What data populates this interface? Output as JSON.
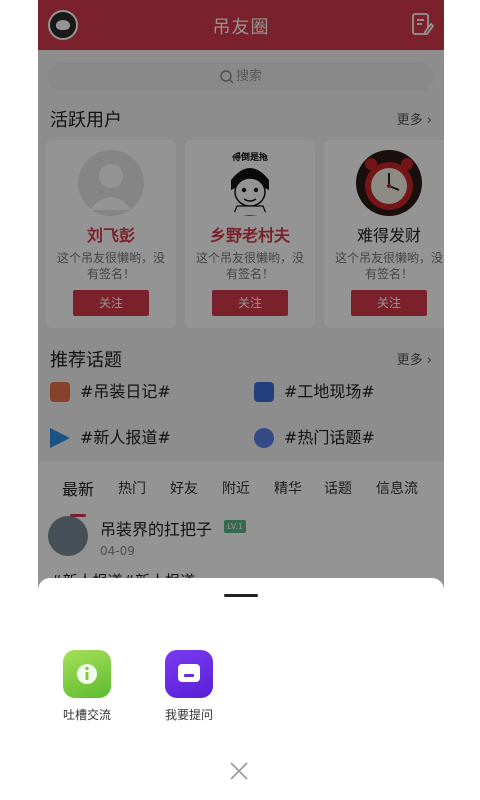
{
  "header": {
    "title": "吊友圈"
  },
  "search": {
    "placeholder": "搜索"
  },
  "active_users": {
    "heading": "活跃用户",
    "more": "更多",
    "users": [
      {
        "name": "刘飞彭",
        "signature": "这个吊友很懒哟，没有签名！",
        "follow": "关注"
      },
      {
        "name": "乡野老村夫",
        "signature": "这个吊友很懒哟，没有签名！",
        "follow": "关注",
        "avatar_text": "得倒是拖"
      },
      {
        "name": "难得发财",
        "signature": "这个吊友很懒哟，没有签名！",
        "follow": "关注"
      }
    ]
  },
  "topics": {
    "heading": "推荐话题",
    "more": "更多",
    "items": [
      {
        "label": "#吊装日记#",
        "color": "#e8734a"
      },
      {
        "label": "#工地现场#",
        "color": "#3a6ed8"
      },
      {
        "label": "#新人报道#",
        "color": "#2f8fe0"
      },
      {
        "label": "#热门话题#",
        "color": "#5b7ee5"
      }
    ]
  },
  "feed": {
    "tabs": [
      "最新",
      "热门",
      "好友",
      "附近",
      "精华",
      "话题",
      "信息流"
    ],
    "post": {
      "title": "吊装界的扛把子",
      "badge": "LV.1",
      "date": "04-09",
      "excerpt": "#新人报道#新人报道"
    }
  },
  "sheet": {
    "actions": [
      {
        "label": "吐槽交流",
        "color": "#7cc93e"
      },
      {
        "label": "我要提问",
        "color": "#6a2be0"
      }
    ]
  },
  "colors": {
    "brand": "#d4394a"
  }
}
